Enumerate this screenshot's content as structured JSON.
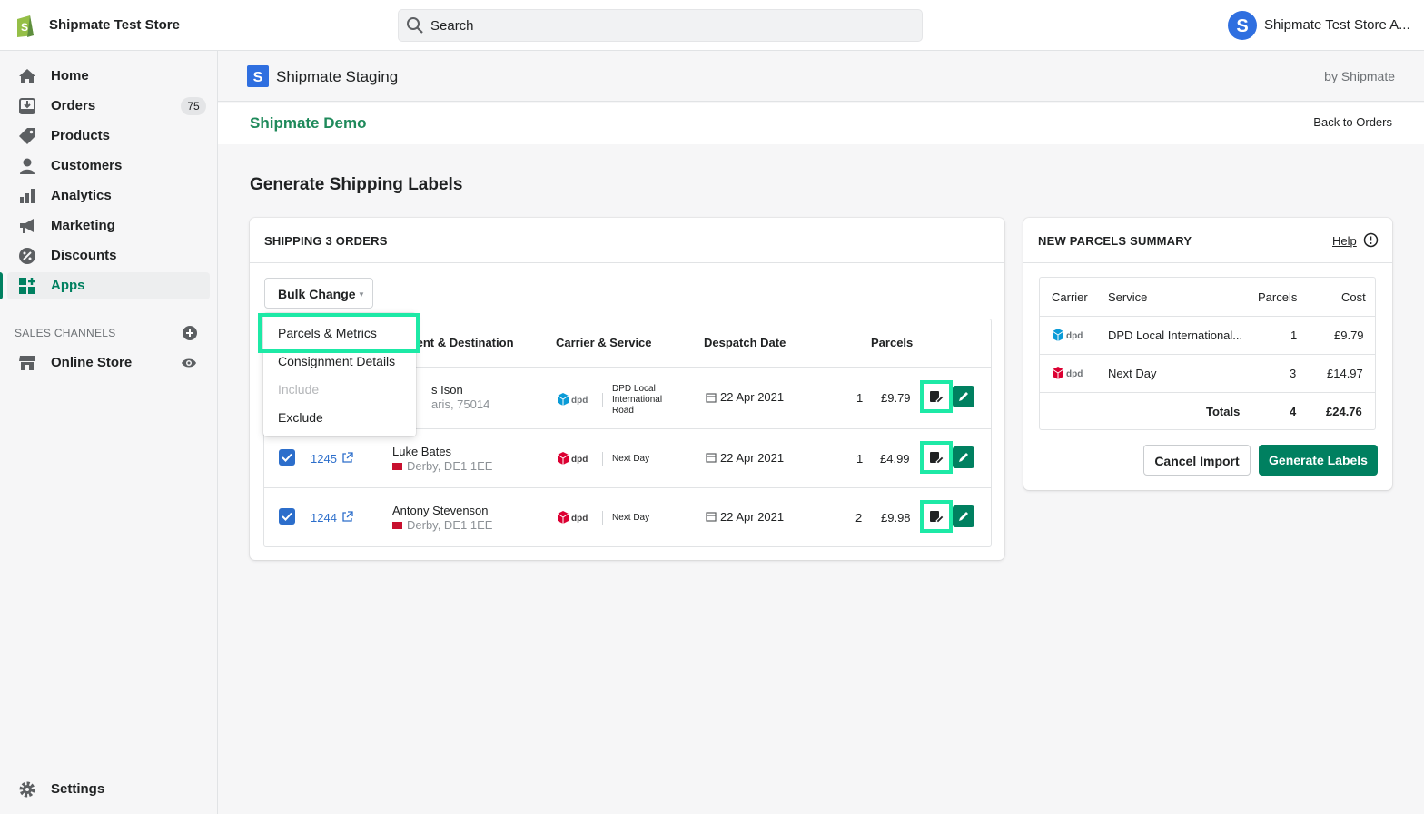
{
  "topbar": {
    "store_name": "Shipmate Test Store",
    "search_placeholder": "Search",
    "user_name": "Shipmate Test Store A..."
  },
  "sidebar": {
    "items": [
      {
        "label": "Home",
        "icon": "home-icon"
      },
      {
        "label": "Orders",
        "icon": "orders-icon",
        "badge": "75"
      },
      {
        "label": "Products",
        "icon": "tag-icon"
      },
      {
        "label": "Customers",
        "icon": "person-icon"
      },
      {
        "label": "Analytics",
        "icon": "bar-chart-icon"
      },
      {
        "label": "Marketing",
        "icon": "megaphone-icon"
      },
      {
        "label": "Discounts",
        "icon": "discount-icon"
      },
      {
        "label": "Apps",
        "icon": "apps-icon",
        "active": true
      }
    ],
    "sales_channels_title": "SALES CHANNELS",
    "online_store": "Online Store",
    "settings": "Settings"
  },
  "app": {
    "title": "Shipmate Staging",
    "by": "by Shipmate",
    "demo_title": "Shipmate Demo",
    "back_link": "Back to Orders",
    "page_title": "Generate Shipping Labels"
  },
  "orders_card": {
    "title": "SHIPPING 3 ORDERS",
    "bulk_change": "Bulk Change",
    "columns": [
      "ient & Destination",
      "Carrier & Service",
      "Despatch Date",
      "Parcels"
    ],
    "dropdown": [
      "Parcels & Metrics",
      "Consignment Details",
      "Include",
      "Exclude"
    ],
    "rows": [
      {
        "order": "",
        "name": "s Ison",
        "location": "aris, 75014",
        "carrier": "dpd",
        "service": "DPD Local International Road",
        "date": "22 Apr 2021",
        "parcels": "1",
        "cost": "£9.79"
      },
      {
        "order": "1245",
        "name": "Luke Bates",
        "location": "Derby, DE1 1EE",
        "carrier": "dpd",
        "service": "Next Day",
        "date": "22 Apr 2021",
        "parcels": "1",
        "cost": "£4.99"
      },
      {
        "order": "1244",
        "name": "Antony Stevenson",
        "location": "Derby, DE1 1EE",
        "carrier": "dpd",
        "service": "Next Day",
        "date": "22 Apr 2021",
        "parcels": "2",
        "cost": "£9.98"
      }
    ]
  },
  "summary_card": {
    "title": "NEW PARCELS SUMMARY",
    "help": "Help",
    "columns": [
      "Carrier",
      "Service",
      "Parcels",
      "Cost"
    ],
    "rows": [
      {
        "carrier": "dpd",
        "service": "DPD Local International...",
        "parcels": "1",
        "cost": "£9.79"
      },
      {
        "carrier": "dpd",
        "service": "Next Day",
        "parcels": "3",
        "cost": "£14.97"
      }
    ],
    "totals_label": "Totals",
    "totals_parcels": "4",
    "totals_cost": "£24.76",
    "cancel": "Cancel Import",
    "generate": "Generate Labels"
  },
  "colors": {
    "accent": "#008060",
    "link": "#2c6ecb",
    "highlight": "#1de9a6",
    "dpd_red": "#dc0032",
    "dpd_blue": "#0a9bd7"
  }
}
